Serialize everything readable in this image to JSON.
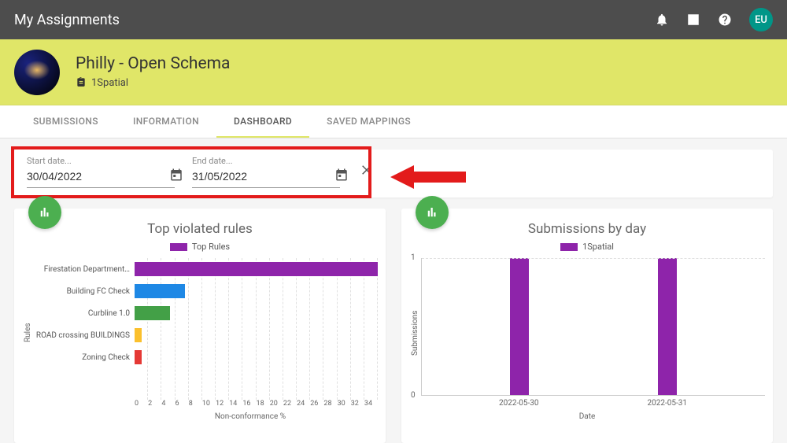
{
  "topbar": {
    "title": "My Assignments",
    "avatar_initials": "EU"
  },
  "project": {
    "title": "Philly - Open Schema",
    "org": "1Spatial"
  },
  "tabs": [
    {
      "label": "SUBMISSIONS",
      "active": false
    },
    {
      "label": "INFORMATION",
      "active": false
    },
    {
      "label": "DASHBOARD",
      "active": true
    },
    {
      "label": "SAVED MAPPINGS",
      "active": false
    }
  ],
  "date_range": {
    "start_label": "Start date...",
    "start_value": "30/04/2022",
    "end_label": "End date...",
    "end_value": "31/05/2022"
  },
  "chart1": {
    "title": "Top violated rules",
    "legend": "Top Rules",
    "ylabel": "Rules",
    "xlabel": "Non-conformance %"
  },
  "chart2": {
    "title": "Submissions by day",
    "legend": "1Spatial",
    "ylabel": "Submissions",
    "xlabel": "Date"
  },
  "chart_data": [
    {
      "type": "bar",
      "orientation": "horizontal",
      "title": "Top violated rules",
      "xlabel": "Non-conformance %",
      "ylabel": "Rules",
      "xlim": [
        0,
        34
      ],
      "categories": [
        "Firestation Department…",
        "Building FC Check",
        "Curbline 1.0",
        "ROAD crossing BUILDINGS",
        "Zoning Check"
      ],
      "values": [
        34,
        7,
        5,
        1,
        1
      ],
      "colors": [
        "#8e24aa",
        "#1e88e5",
        "#43a047",
        "#fbc02d",
        "#e53935"
      ],
      "legend": [
        "Top Rules"
      ],
      "xticks": [
        0,
        2,
        4,
        6,
        8,
        10,
        12,
        14,
        16,
        18,
        20,
        22,
        24,
        26,
        28,
        30,
        32,
        34
      ]
    },
    {
      "type": "bar",
      "orientation": "vertical",
      "title": "Submissions by day",
      "xlabel": "Date",
      "ylabel": "Submissions",
      "ylim": [
        0,
        1
      ],
      "categories": [
        "2022-05-30",
        "2022-05-31"
      ],
      "values": [
        1,
        1
      ],
      "legend": [
        "1Spatial"
      ],
      "yticks": [
        0,
        1
      ]
    }
  ]
}
